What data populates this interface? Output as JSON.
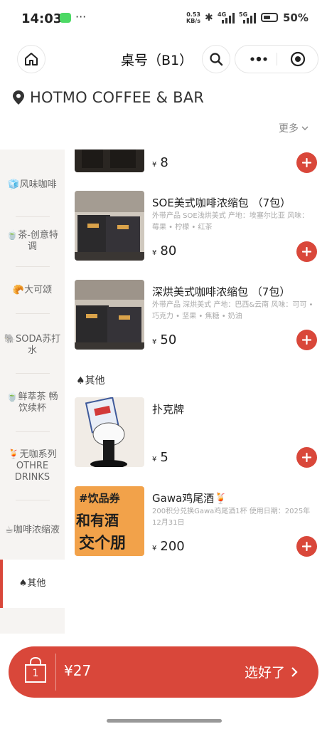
{
  "status_bar": {
    "time": "14:03",
    "net_speed_value": "0.53",
    "net_speed_unit": "KB/s",
    "net1": "4G",
    "net2": "5G",
    "battery": "50%"
  },
  "nav": {
    "title": "桌号（B1）"
  },
  "store": {
    "name": "HOTMO COFFEE & BAR",
    "more_label": "更多"
  },
  "categories": [
    {
      "emoji": "🧊",
      "label": "风味咖啡",
      "active": false
    },
    {
      "emoji": "🍵",
      "label": "茶-创意特调",
      "active": false
    },
    {
      "emoji": "🥐",
      "label": "大可颂",
      "active": false
    },
    {
      "emoji": "🐘",
      "label": "SODA苏打水",
      "active": false
    },
    {
      "emoji": "🍵",
      "label": "鲜萃茶 畅饮续杯",
      "active": false
    },
    {
      "emoji": "🍹",
      "label": "无咖系列 OTHRE DRINKS",
      "active": false
    },
    {
      "emoji": "☕",
      "label": "咖啡浓缩液",
      "active": false
    },
    {
      "emoji": "♠",
      "label": "其他",
      "active": true
    }
  ],
  "products": [
    {
      "name": "",
      "desc": "",
      "price": "8",
      "currency": "¥"
    },
    {
      "name": "SOE美式咖啡浓缩包 （7包）",
      "desc": "外带产品 SOE浅烘美式 产地：埃塞尔比亚 风味：莓果 • 柠檬 • 红茶",
      "price": "80",
      "currency": "¥"
    },
    {
      "name": "深烘美式咖啡浓缩包 （7包）",
      "desc": "外带产品 深烘美式 产地：巴西&云南 风味：可可 • 巧克力 • 坚果 • 焦糖 • 奶油",
      "price": "50",
      "currency": "¥"
    }
  ],
  "section_other": {
    "icon": "♠",
    "title": "其他"
  },
  "other_products": [
    {
      "name": "扑克牌",
      "desc": "",
      "price": "5",
      "currency": "¥"
    },
    {
      "name": "Gawa鸡尾酒🍹",
      "desc": "200积分兑换Gawa鸡尾酒1杯 使用日期：2025年12月31日",
      "price": "200",
      "currency": "¥",
      "image_text": {
        "line1": "#饮品券",
        "line2": "和有酒",
        "line3": "交个朋"
      }
    }
  ],
  "cart": {
    "count": "1",
    "total": "¥27",
    "checkout_label": "选好了"
  },
  "colors": {
    "accent": "#d9473a",
    "sidebar_bg": "#f6f4f2"
  }
}
